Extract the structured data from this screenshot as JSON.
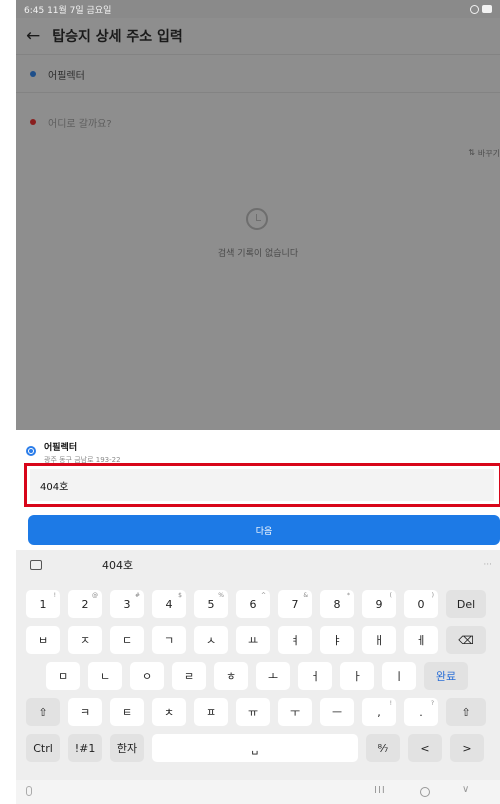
{
  "status_bar": {
    "time_date": "6:45  11월 7일 금요일"
  },
  "header": {
    "title": "탑승지 상세 주소 입력"
  },
  "route": {
    "origin": "어필렉터",
    "destination_placeholder": "어디로 갈까요?"
  },
  "swap_label": "바꾸기",
  "empty_state": {
    "message": "검색 기록이 없습니다"
  },
  "sheet": {
    "place_name": "어필렉터",
    "place_address": "광주 동구 금남로 193-22",
    "detail_value": "404호",
    "next_label": "다음"
  },
  "keyboard": {
    "suggestion": "404호",
    "more": "···",
    "row1": [
      {
        "label": "1",
        "sub": "!"
      },
      {
        "label": "2",
        "sub": "@"
      },
      {
        "label": "3",
        "sub": "#"
      },
      {
        "label": "4",
        "sub": "$"
      },
      {
        "label": "5",
        "sub": "%"
      },
      {
        "label": "6",
        "sub": "^"
      },
      {
        "label": "7",
        "sub": "&"
      },
      {
        "label": "8",
        "sub": "*"
      },
      {
        "label": "9",
        "sub": "("
      },
      {
        "label": "0",
        "sub": ")"
      },
      {
        "label": "Del",
        "sub": ""
      }
    ],
    "row2": [
      "ㅂ",
      "ㅈ",
      "ㄷ",
      "ㄱ",
      "ㅅ",
      "ㅛ",
      "ㅕ",
      "ㅑ",
      "ㅐ",
      "ㅔ"
    ],
    "row3": [
      "ㅁ",
      "ㄴ",
      "ㅇ",
      "ㄹ",
      "ㅎ",
      "ㅗ",
      "ㅓ",
      "ㅏ",
      "ㅣ"
    ],
    "done_label": "완료",
    "row4": [
      "ㅋ",
      "ㅌ",
      "ㅊ",
      "ㅍ",
      "ㅠ",
      "ㅜ",
      "ㅡ"
    ],
    "row4_punct": [
      {
        "label": ",",
        "sub": "!"
      },
      {
        "label": ".",
        "sub": "?"
      }
    ],
    "ctrl_label": "Ctrl",
    "sym_label": "!#1",
    "hanja_label": "한자",
    "layout_label": "⁸⁄₇",
    "left_arrow": "<",
    "right_arrow": ">"
  },
  "colors": {
    "accent": "#1d7ae6",
    "highlight_border": "#d8061a",
    "dim_overlay": "#8e8e8e"
  }
}
